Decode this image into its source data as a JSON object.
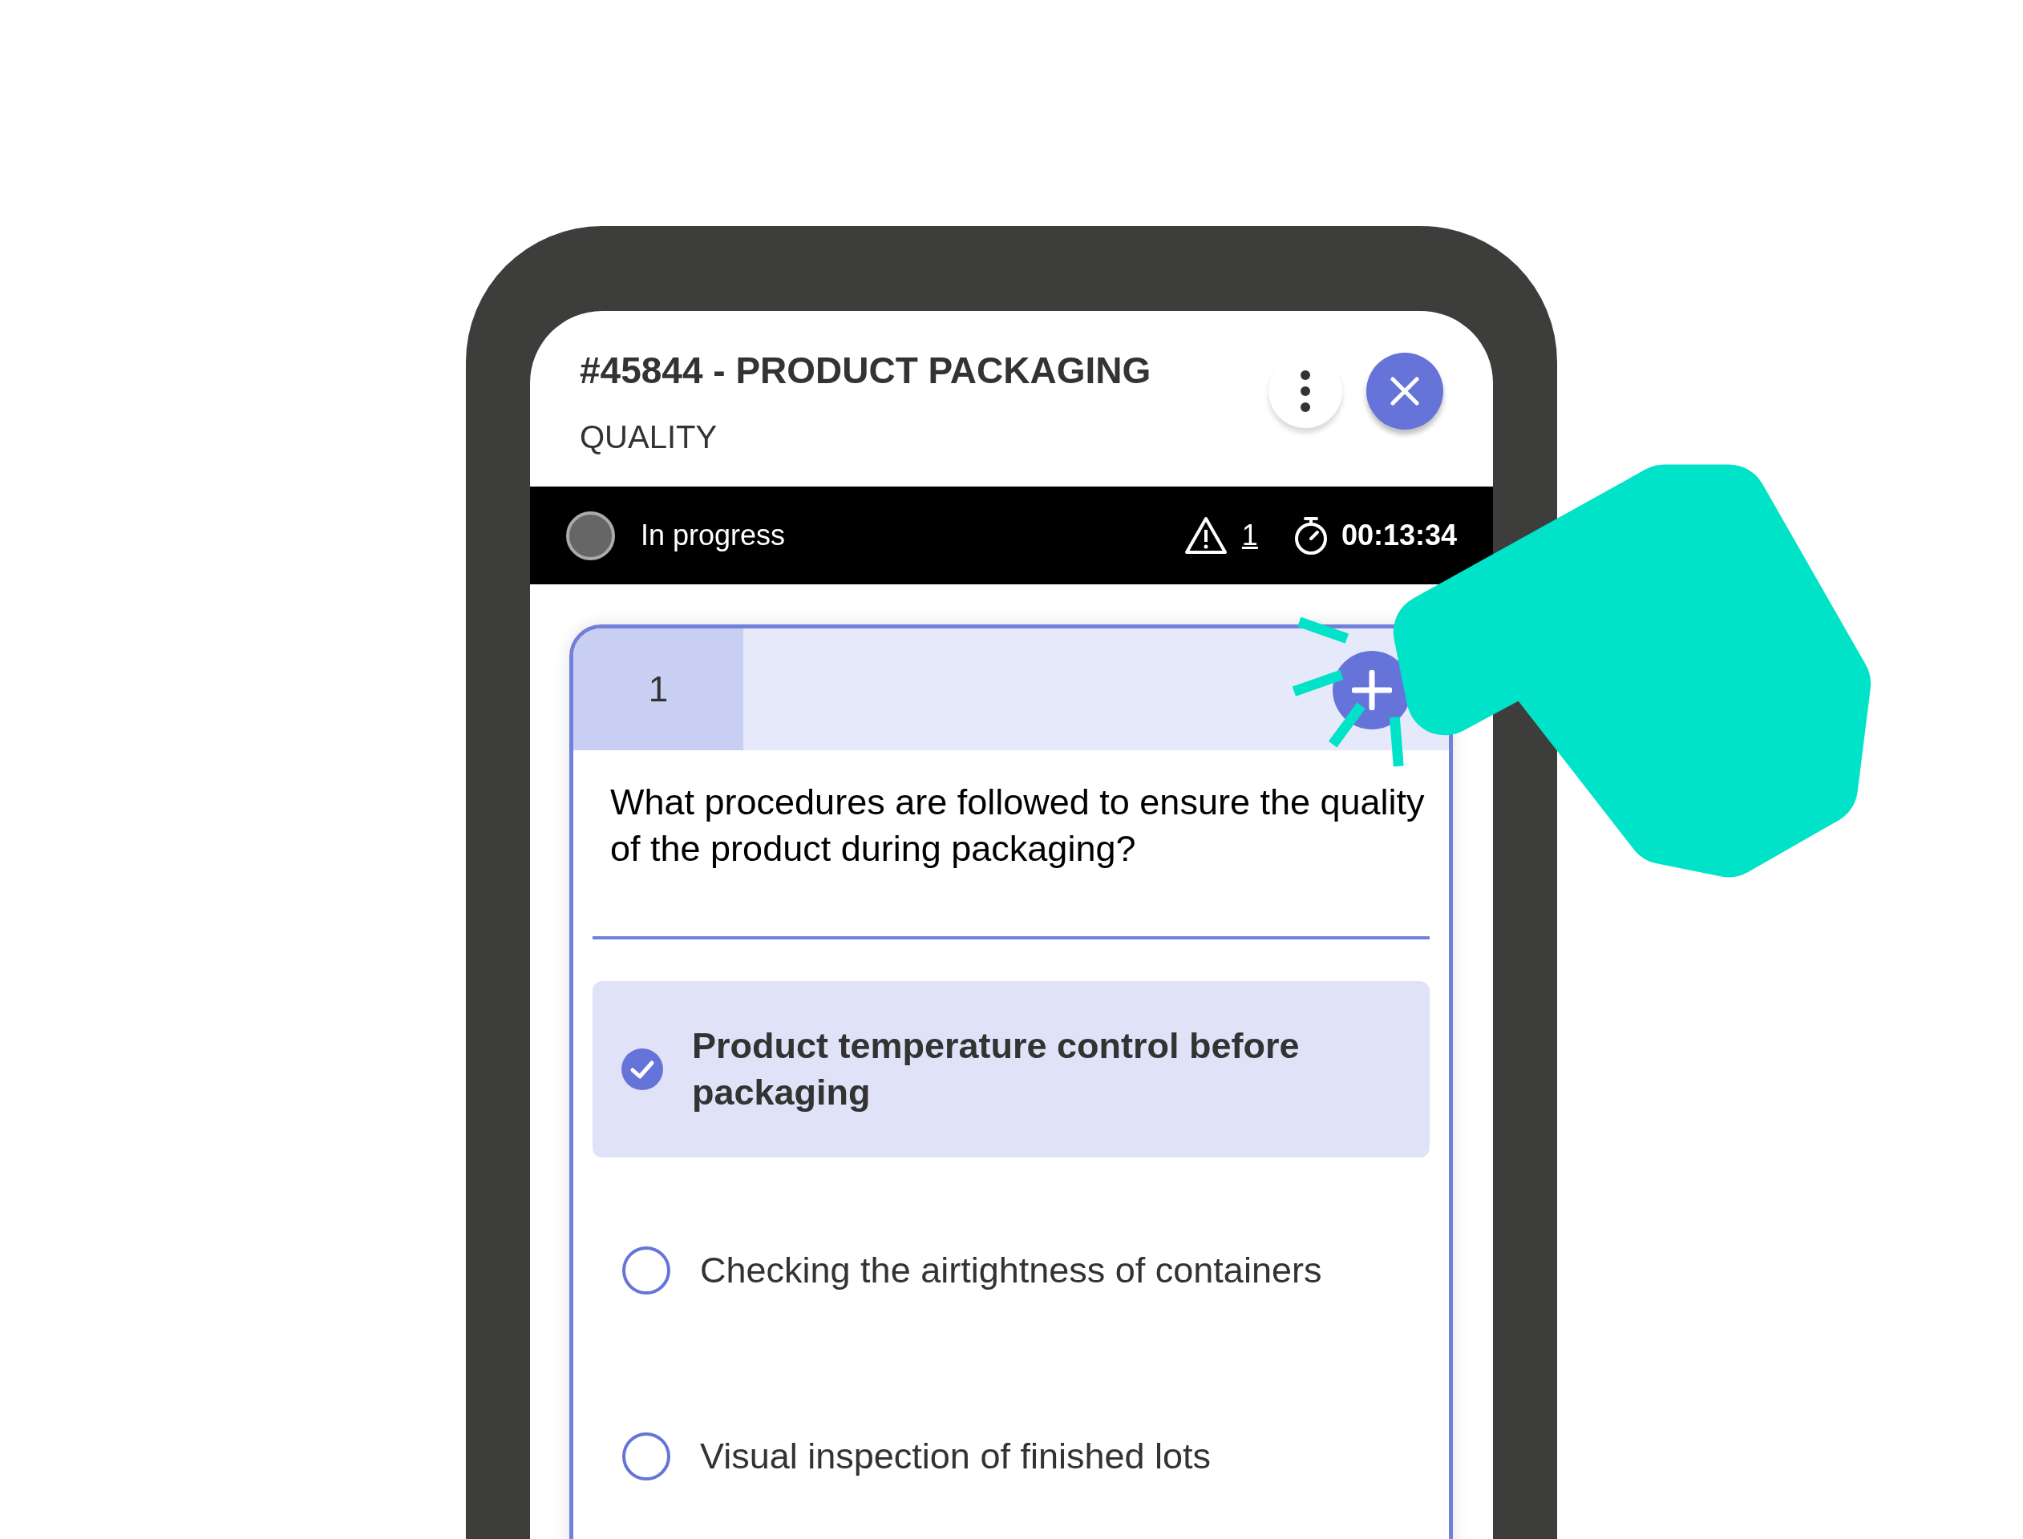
{
  "header": {
    "title": "#45844 - PRODUCT PACKAGING",
    "subtitle": "QUALITY"
  },
  "status_bar": {
    "status": "In progress",
    "warnings": "1",
    "timer": "00:13:34"
  },
  "question": {
    "number": "1",
    "text": "What procedures are followed to ensure the quality of the product during packaging?",
    "options": [
      {
        "label": "Product temperature control before packaging",
        "selected": true
      },
      {
        "label": "Checking the airtightness of containers",
        "selected": false
      },
      {
        "label": "Visual inspection of finished lots",
        "selected": false
      }
    ]
  }
}
